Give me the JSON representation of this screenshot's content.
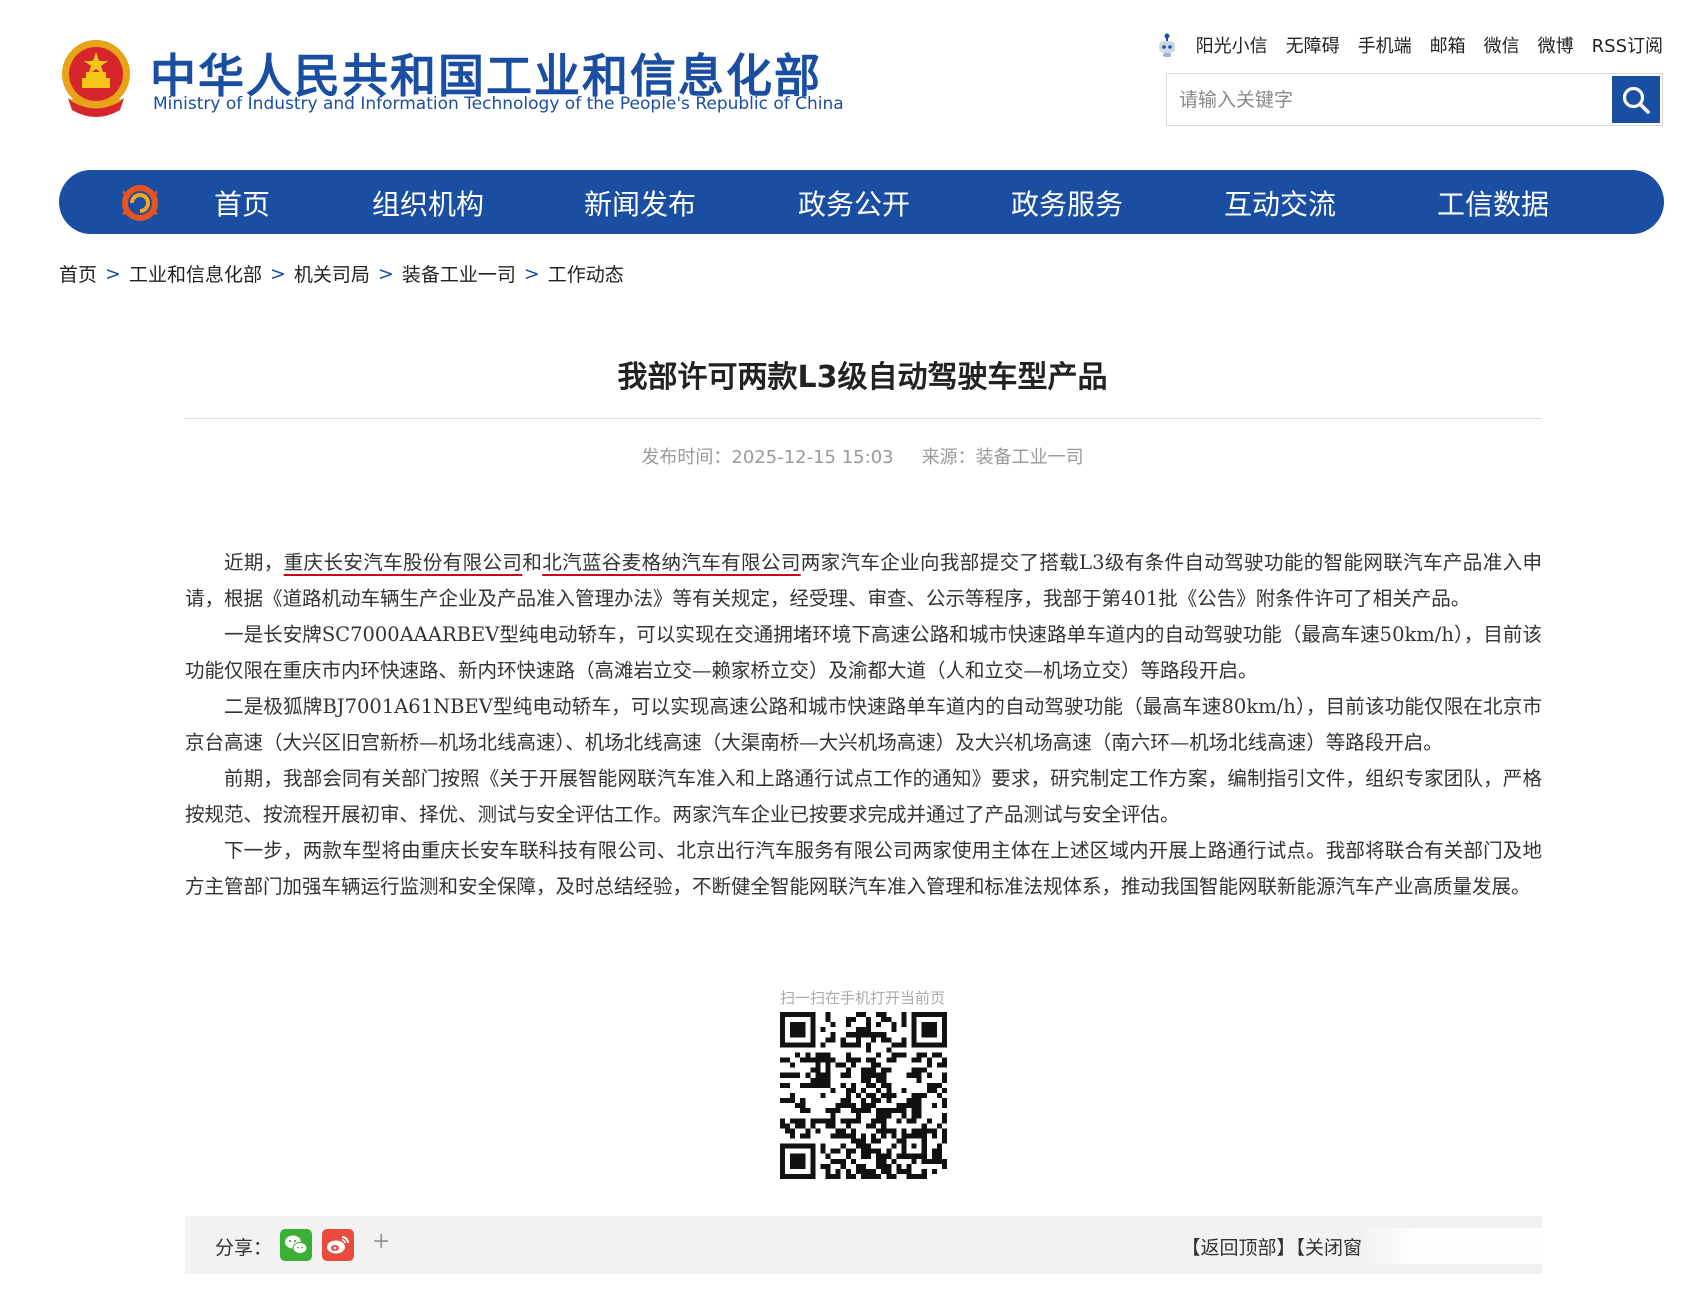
{
  "header": {
    "title_cn": "中华人民共和国工业和信息化部",
    "title_en": "Ministry of Industry and Information Technology of the People's Republic of China",
    "emblem_icon": "national-emblem-icon"
  },
  "toplinks": [
    {
      "label": "阳光小信"
    },
    {
      "label": "无障碍"
    },
    {
      "label": "手机端"
    },
    {
      "label": "邮箱"
    },
    {
      "label": "微信"
    },
    {
      "label": "微博"
    },
    {
      "label": "RSS订阅"
    }
  ],
  "search": {
    "placeholder": "请输入关键字",
    "value": ""
  },
  "nav": [
    {
      "label": "首页"
    },
    {
      "label": "组织机构"
    },
    {
      "label": "新闻发布"
    },
    {
      "label": "政务公开"
    },
    {
      "label": "政务服务"
    },
    {
      "label": "互动交流"
    },
    {
      "label": "工信数据"
    }
  ],
  "breadcrumb": [
    {
      "label": "首页"
    },
    {
      "label": "工业和信息化部"
    },
    {
      "label": "机关司局"
    },
    {
      "label": "装备工业一司"
    },
    {
      "label": "工作动态"
    }
  ],
  "breadcrumb_sep": ">",
  "article": {
    "title": "我部许可两款L3级自动驾驶车型产品",
    "publish_label": "发布时间：",
    "publish_time": "2025-12-15 15:03",
    "source_label": "来源：",
    "source": "装备工业一司",
    "p1_pre": "近期，",
    "p1_company1": "重庆长安汽车股份有限公司",
    "p1_mid": "和",
    "p1_company2": "北汽蓝谷麦格纳汽车有限公司",
    "p1_post": "两家汽车企业向我部提交了搭载L3级有条件自动驾驶功能的智能网联汽车产品准入申请，根据《道路机动车辆生产企业及产品准入管理办法》等有关规定，经受理、审查、公示等程序，我部于第401批《公告》附条件许可了相关产品。",
    "p2": "一是长安牌SC7000AAARBEV型纯电动轿车，可以实现在交通拥堵环境下高速公路和城市快速路单车道内的自动驾驶功能（最高车速50km/h），目前该功能仅限在重庆市内环快速路、新内环快速路（高滩岩立交—赖家桥立交）及渝都大道（人和立交—机场立交）等路段开启。",
    "p3": "二是极狐牌BJ7001A61NBEV型纯电动轿车，可以实现高速公路和城市快速路单车道内的自动驾驶功能（最高车速80km/h），目前该功能仅限在北京市京台高速（大兴区旧宫新桥—机场北线高速）、机场北线高速（大渠南桥—大兴机场高速）及大兴机场高速（南六环—机场北线高速）等路段开启。",
    "p4": "前期，我部会同有关部门按照《关于开展智能网联汽车准入和上路通行试点工作的通知》要求，研究制定工作方案，编制指引文件，组织专家团队，严格按规范、按流程开展初审、择优、测试与安全评估工作。两家汽车企业已按要求完成并通过了产品测试与安全评估。",
    "p5": "下一步，两款车型将由重庆长安车联科技有限公司、北京出行汽车服务有限公司两家使用主体在上述区域内开展上路通行试点。我部将联合有关部门及地方主管部门加强车辆运行监测和安全保障，及时总结经验，不断健全智能网联汽车准入管理和标准法规体系，推动我国智能网联新能源汽车产业高质量发展。"
  },
  "qr": {
    "caption": "扫一扫在手机打开当前页"
  },
  "sharebar": {
    "share_label": "分享：",
    "more": "+",
    "back_top": "【返回顶部】",
    "close": "【关闭窗"
  },
  "colors": {
    "brand": "#1a4ea3",
    "underline": "#d0021b",
    "bar_bg": "#f2f2f2"
  }
}
